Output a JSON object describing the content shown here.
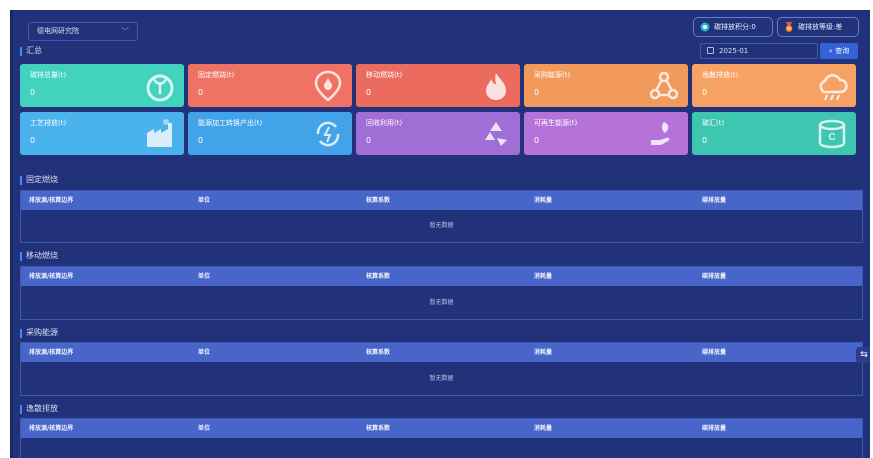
{
  "header": {
    "org_select": "德电网研究院",
    "points_btn": "碳排放积分:0",
    "grade_btn": "碳排放等级:差",
    "date_value": "2025-01",
    "query_btn": "查询"
  },
  "summary": {
    "title": "汇总",
    "cards": [
      {
        "label": "碳排总量(t)",
        "value": "0",
        "color": "#43d2be",
        "icon": "sprout-icon"
      },
      {
        "label": "固定燃烧(t)",
        "value": "0",
        "color": "#ef7365",
        "icon": "fire-location-icon"
      },
      {
        "label": "移动燃烧(t)",
        "value": "0",
        "color": "#ec6b5f",
        "icon": "flame-icon"
      },
      {
        "label": "采购能源(t)",
        "value": "0",
        "color": "#f19a5b",
        "icon": "recycle-triangle-icon"
      },
      {
        "label": "逸散排放(t)",
        "value": "0",
        "color": "#f6a265",
        "icon": "cloud-icon"
      },
      {
        "label": "工艺排放(t)",
        "value": "0",
        "color": "#4ab3ec",
        "icon": "factory-icon"
      },
      {
        "label": "能源加工转换产出(t)",
        "value": "0",
        "color": "#43a3e9",
        "icon": "energy-convert-icon"
      },
      {
        "label": "回收利用(t)",
        "value": "0",
        "color": "#a06ed4",
        "icon": "recycle-icon"
      },
      {
        "label": "可再生能源(t)",
        "value": "0",
        "color": "#b573da",
        "icon": "hand-leaf-icon"
      },
      {
        "label": "碳汇(t)",
        "value": "0",
        "color": "#3ec6b0",
        "icon": "carbon-coin-icon"
      }
    ]
  },
  "table_columns": [
    "排放源/核算边界",
    "单位",
    "核算系数",
    "消耗量",
    "碳排放量"
  ],
  "empty_text": "暂无数据",
  "sections": [
    {
      "title": "固定燃烧"
    },
    {
      "title": "移动燃烧"
    },
    {
      "title": "采购能源"
    },
    {
      "title": "逸散排放"
    }
  ],
  "side_tab": "⇆"
}
